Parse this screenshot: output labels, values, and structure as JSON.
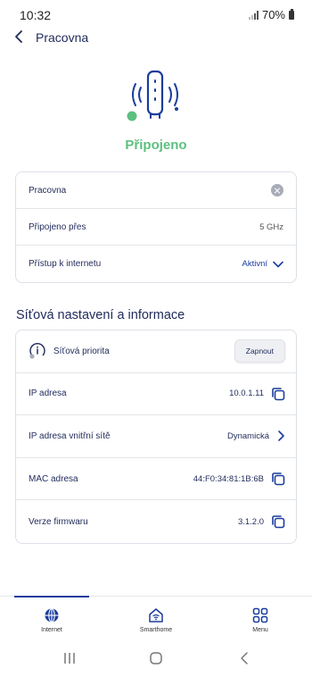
{
  "status_bar": {
    "time": "10:32",
    "battery": "70%"
  },
  "header": {
    "title": "Pracovna"
  },
  "device": {
    "status": "Připojeno",
    "status_color": "#5bc07f"
  },
  "card1": {
    "name_value": "Pracovna",
    "connected_via_label": "Připojeno přes",
    "connected_via_value": "5 GHz",
    "internet_label": "Přístup k internetu",
    "internet_value": "Aktivní"
  },
  "section": {
    "title": "Síťová nastavení a informace"
  },
  "card2": {
    "priority_label": "Síťová priorita",
    "priority_button": "Zapnout",
    "ip_label": "IP adresa",
    "ip_value": "10.0.1.11",
    "lan_ip_label": "IP adresa vnitřní sítě",
    "lan_ip_value": "Dynamická",
    "mac_label": "MAC adresa",
    "mac_value": "44:F0:34:81:1B:6B",
    "fw_label": "Verze firmwaru",
    "fw_value": "3.1.2.0"
  },
  "nav": {
    "internet": "Internet",
    "smarthome": "Smarthome",
    "menu": "Menu"
  },
  "colors": {
    "accent": "#1a3d9c",
    "text": "#1f2a5a",
    "green": "#5bc07f"
  }
}
